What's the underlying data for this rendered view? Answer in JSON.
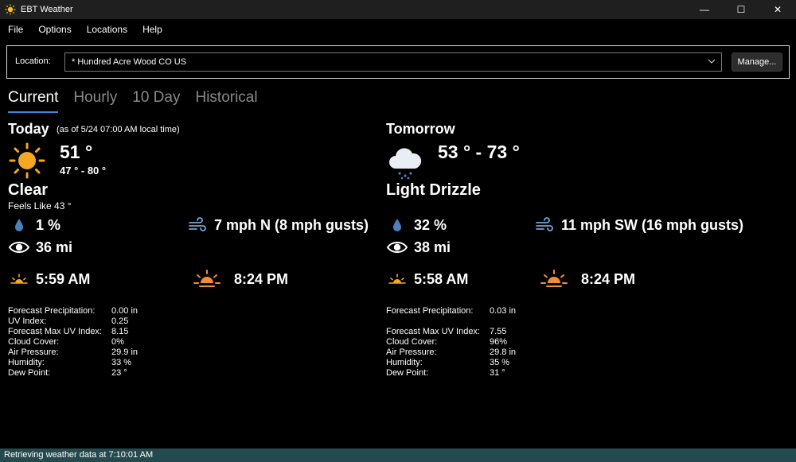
{
  "window": {
    "title": "EBT Weather",
    "minimize_glyph": "—",
    "maximize_glyph": "☐",
    "close_glyph": "✕"
  },
  "menu": [
    "File",
    "Options",
    "Locations",
    "Help"
  ],
  "location": {
    "label": "Location:",
    "value": "* Hundred Acre Wood CO US",
    "manage_label": "Manage..."
  },
  "tabs": [
    "Current",
    "Hourly",
    "10 Day",
    "Historical"
  ],
  "today": {
    "title": "Today",
    "as_of": "(as of  5/24 07:00 AM local time)",
    "icon": "sun-icon",
    "temp": "51 °",
    "temp_range": "47 ° - 80 °",
    "condition": "Clear",
    "feels_like": "Feels Like 43 °",
    "precip_chance": "1 %",
    "wind": "7 mph N (8 mph gusts)",
    "visibility": "36 mi",
    "sunrise": "5:59 AM",
    "sunset": "8:24 PM",
    "details": [
      {
        "label": "Forecast Precipitation:",
        "value": "0.00 in"
      },
      {
        "label": "UV Index:",
        "value": "0.25"
      },
      {
        "label": "Forecast Max UV Index:",
        "value": "8.15"
      },
      {
        "label": "Cloud Cover:",
        "value": "0%"
      },
      {
        "label": "Air Pressure:",
        "value": "29.9 in"
      },
      {
        "label": "Humidity:",
        "value": "33 %"
      },
      {
        "label": "Dew Point:",
        "value": "23 °"
      }
    ]
  },
  "tomorrow": {
    "title": "Tomorrow",
    "icon": "cloud-drizzle-icon",
    "temp": "53 ° - 73 °",
    "condition": "Light Drizzle",
    "precip_chance": "32 %",
    "wind": "11 mph SW (16 mph gusts)",
    "visibility": "38 mi",
    "sunrise": "5:58 AM",
    "sunset": "8:24 PM",
    "details": [
      {
        "label": "Forecast Precipitation:",
        "value": "0.03 in"
      },
      {
        "label": "",
        "value": ""
      },
      {
        "label": "Forecast Max UV Index:",
        "value": "7.55"
      },
      {
        "label": "Cloud Cover:",
        "value": "96%"
      },
      {
        "label": "Air Pressure:",
        "value": "29.8 in"
      },
      {
        "label": "Humidity:",
        "value": "35 %"
      },
      {
        "label": "Dew Point:",
        "value": "31 °"
      }
    ]
  },
  "status": {
    "text": "Retrieving weather data at 7:10:01 AM"
  },
  "colors": {
    "accent": "#3a8ad8",
    "status_bar": "#24494f",
    "sun": "#f5a623",
    "drop": "#4d7fb8",
    "wind_icon": "#6fa8dc"
  }
}
